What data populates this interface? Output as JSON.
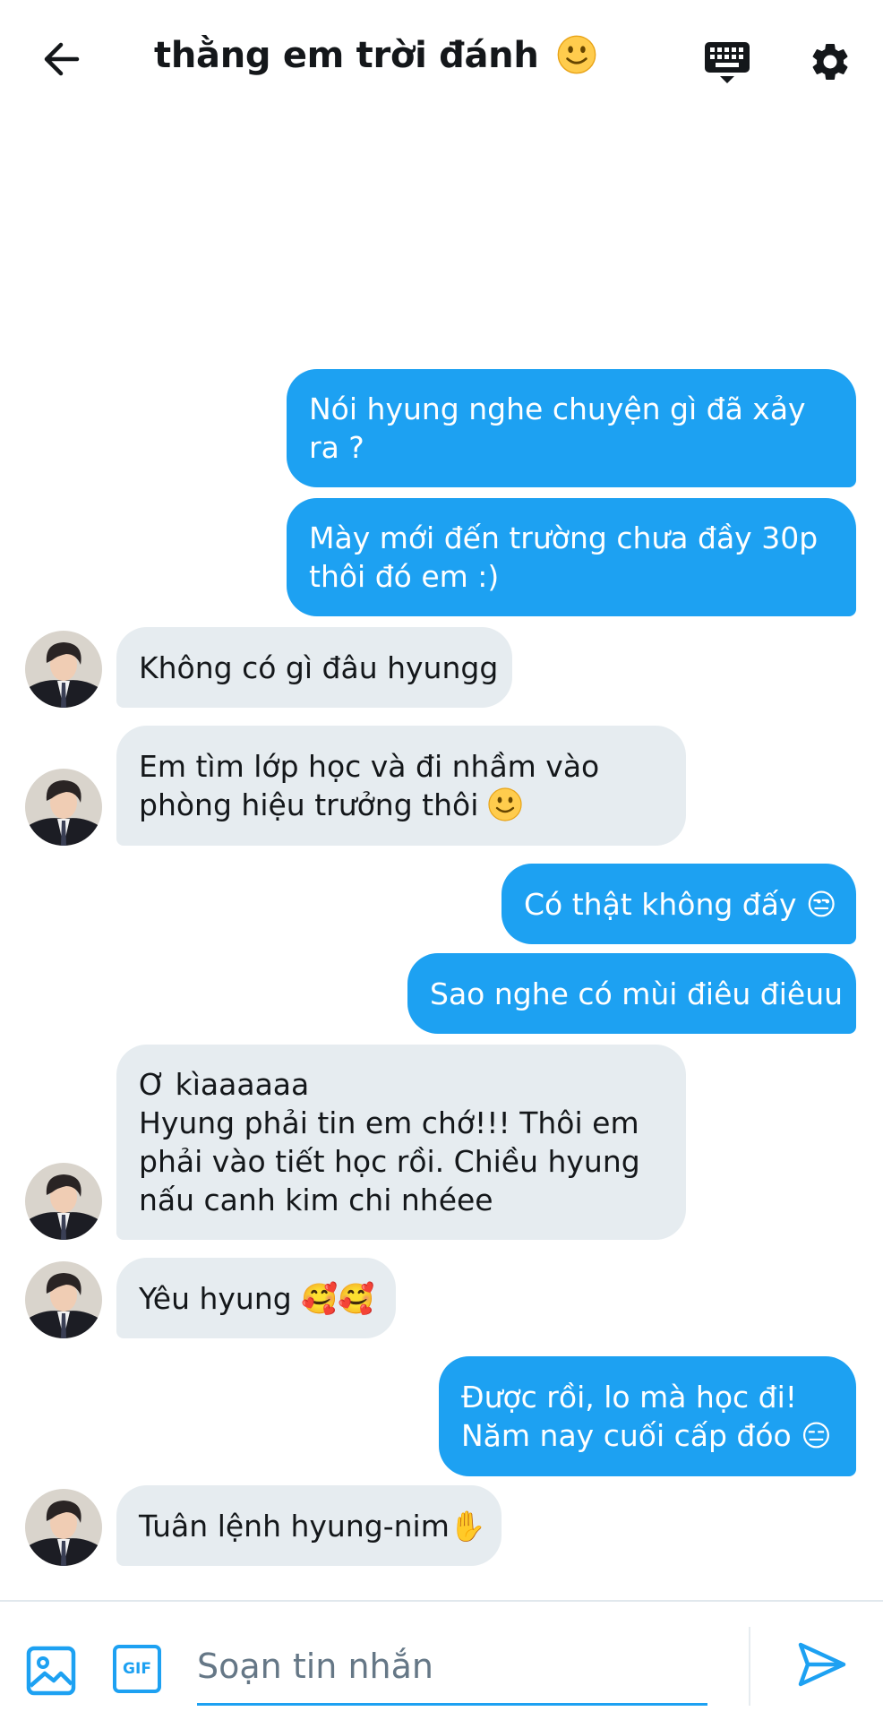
{
  "header": {
    "title": "thằng em trời đánh",
    "back_icon": "arrow-left-icon",
    "keyboard_icon": "keyboard-icon",
    "settings_icon": "gear-icon"
  },
  "colors": {
    "accent": "#1da1f2",
    "received_bubble": "#e6ecf0",
    "text": "#14171a",
    "placeholder": "#657786"
  },
  "messages": [
    {
      "side": "sent",
      "lines": [
        "Nói hyung nghe chuyện gì đã xảy",
        "ra ?"
      ]
    },
    {
      "side": "sent",
      "lines": [
        "Mày mới đến trường chưa đầy 30p",
        "thôi đó em :)"
      ]
    },
    {
      "side": "received",
      "lines": [
        "Không có gì đâu hyungg"
      ]
    },
    {
      "side": "received",
      "lines": [
        "Em tìm lớp học và đi nhầm vào",
        "phòng hiệu trưởng thôi"
      ]
    },
    {
      "side": "sent",
      "lines": [
        "Có thật không đấy 😒"
      ]
    },
    {
      "side": "sent",
      "lines": [
        "Sao nghe có mùi điêu điêuu"
      ]
    },
    {
      "side": "received",
      "lines": [
        "Ơ kìaaaaaa",
        "Hyung phải tin em chớ!!! Thôi em",
        "phải vào tiết học rồi. Chiều hyung",
        "nấu canh kim chi nhéee"
      ]
    },
    {
      "side": "received",
      "lines": [
        "Yêu hyung 🥰🥰"
      ]
    },
    {
      "side": "sent",
      "lines": [
        "Được rồi, lo mà học đi!",
        "Năm nay cuối cấp đóo 😑"
      ]
    },
    {
      "side": "received",
      "lines": [
        "Tuân lệnh hyung-nim✋"
      ]
    }
  ],
  "composer": {
    "placeholder": "Soạn tin nhắn",
    "gif_label": "GIF",
    "image_icon": "image-icon",
    "send_icon": "send-icon"
  }
}
